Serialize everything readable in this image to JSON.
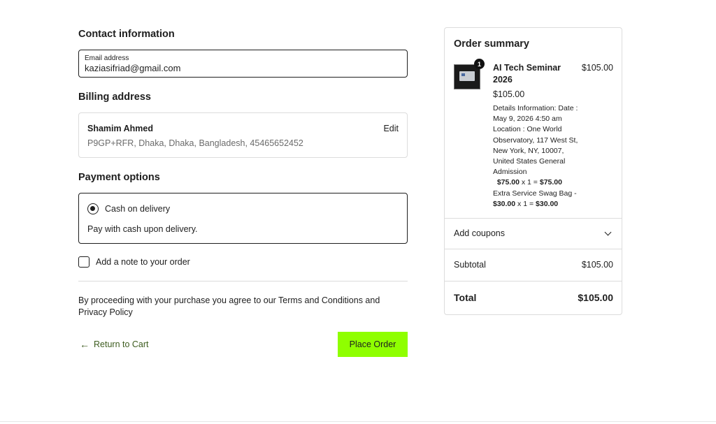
{
  "contact": {
    "heading": "Contact information",
    "email_label": "Email address",
    "email_value": "kaziasifriad@gmail.com"
  },
  "billing": {
    "heading": "Billing address",
    "name": "Shamim Ahmed",
    "address": "P9GP+RFR, Dhaka, Dhaka, Bangladesh, 45465652452",
    "edit_label": "Edit"
  },
  "payment": {
    "heading": "Payment options",
    "selected_option": "Cash on delivery",
    "description": "Pay with cash upon delivery."
  },
  "note": {
    "label": "Add a note to your order",
    "checked": false
  },
  "terms": {
    "text": "By proceeding with your purchase you agree to our Terms and Conditions and Privacy Policy"
  },
  "actions": {
    "return_label": "Return to Cart",
    "place_order_label": "Place Order",
    "place_order_color": "#8fff00"
  },
  "summary": {
    "heading": "Order summary",
    "item": {
      "quantity_badge": "1",
      "name": "AI Tech Seminar 2026",
      "price": "$105.00",
      "line_total": "$105.00",
      "details_prefix": "Details Information: Date : May 9, 2026 4:50 am Location : One World Observatory, 117 West St, New York, NY, 10007, United States General Admission",
      "ga_price": "$75.00",
      "ga_qty": " x 1 = ",
      "ga_total": "$75.00",
      "extra_label": "Extra Service Swag Bag -",
      "extra_price": "$30.00",
      "extra_qty": " x 1 = ",
      "extra_total": "$30.00"
    },
    "coupons_label": "Add coupons",
    "subtotal_label": "Subtotal",
    "subtotal_value": "$105.00",
    "total_label": "Total",
    "total_value": "$105.00"
  }
}
